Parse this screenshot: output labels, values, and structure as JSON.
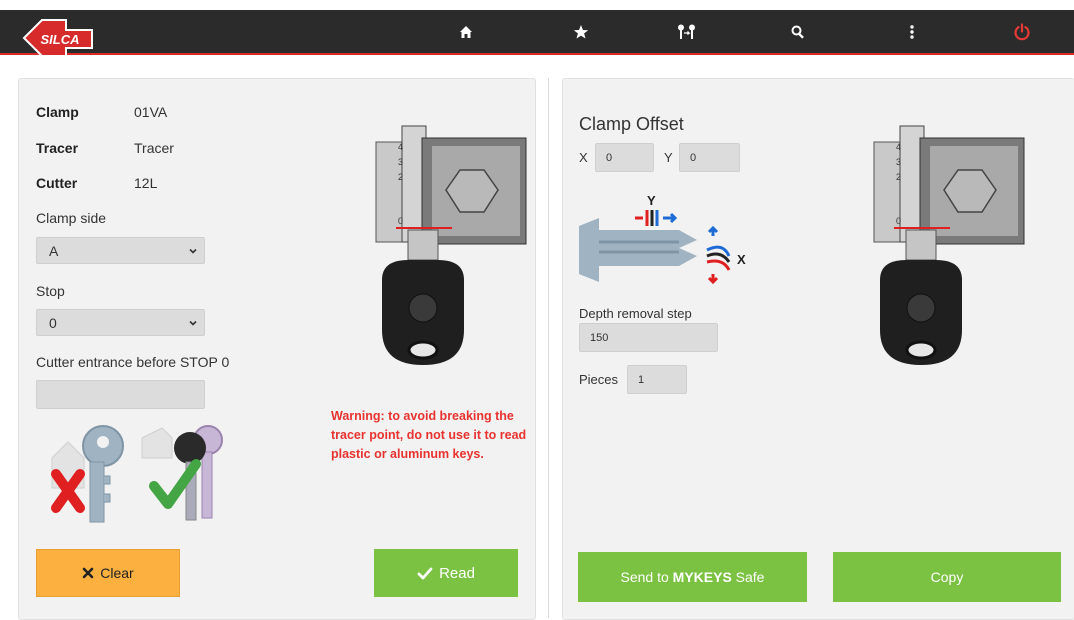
{
  "nav": {
    "items": [
      "home-icon",
      "star-icon",
      "keys-icon",
      "search-icon",
      "more-icon",
      "power-icon"
    ],
    "brand_color": "#d72a2a",
    "logo_text": "SILCA"
  },
  "left": {
    "clamp_label": "Clamp",
    "clamp_value": "01VA",
    "tracer_label": "Tracer",
    "tracer_value": "Tracer",
    "cutter_label": "Cutter",
    "cutter_value": "12L",
    "clamp_side_label": "Clamp side",
    "clamp_side_value": "A",
    "stop_label": "Stop",
    "stop_value": "0",
    "cutter_entrance_label": "Cutter entrance before STOP 0",
    "cutter_entrance_value": "",
    "warning": "Warning: to avoid breaking the tracer point, do not use it to read plastic or aluminum keys.",
    "clear_label": "Clear",
    "read_label": "Read",
    "clamp_marks": [
      "4",
      "3",
      "2",
      "0"
    ]
  },
  "right": {
    "title": "Clamp Offset",
    "x_label": "X",
    "x_value": "0",
    "y_label": "Y",
    "y_value": "0",
    "diagram_y_label": "Y",
    "diagram_x_label": "X",
    "depth_label": "Depth removal step",
    "depth_value": "150",
    "pieces_label": "Pieces",
    "pieces_value": "1",
    "send_prefix": "Send to ",
    "send_bold": "MYKEYS",
    "send_suffix": " Safe",
    "copy_label": "Copy"
  },
  "colors": {
    "accent_green": "#7cc242",
    "clear_orange": "#fbb040",
    "warning_red": "#e8322f"
  }
}
